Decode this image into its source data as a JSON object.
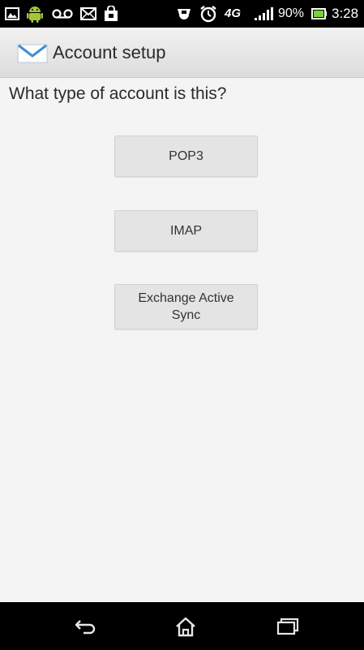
{
  "status_bar": {
    "battery_percent": "90%",
    "time": "3:28",
    "network_type": "4G",
    "icons": [
      "gallery-icon",
      "android-icon",
      "voicemail-icon",
      "email-icon",
      "shopping-bag-icon",
      "vibrate-icon",
      "alarm-icon",
      "network-4g-icon",
      "signal-icon",
      "battery-icon"
    ]
  },
  "action_bar": {
    "title": "Account setup",
    "icon": "mail-envelope-icon"
  },
  "main": {
    "prompt": "What type of account is this?",
    "options": [
      {
        "label": "POP3"
      },
      {
        "label": "IMAP"
      },
      {
        "label": "Exchange Active Sync"
      }
    ]
  },
  "nav_bar": {
    "icons": [
      "back-icon",
      "home-icon",
      "recent-apps-icon"
    ]
  },
  "colors": {
    "status_bar_bg": "#000000",
    "action_bar_bg": "#e6e6e6",
    "content_bg": "#f4f4f4",
    "button_bg": "#e4e4e4",
    "mail_icon_blue": "#3f8fd2",
    "battery_green": "#7ad33a"
  }
}
